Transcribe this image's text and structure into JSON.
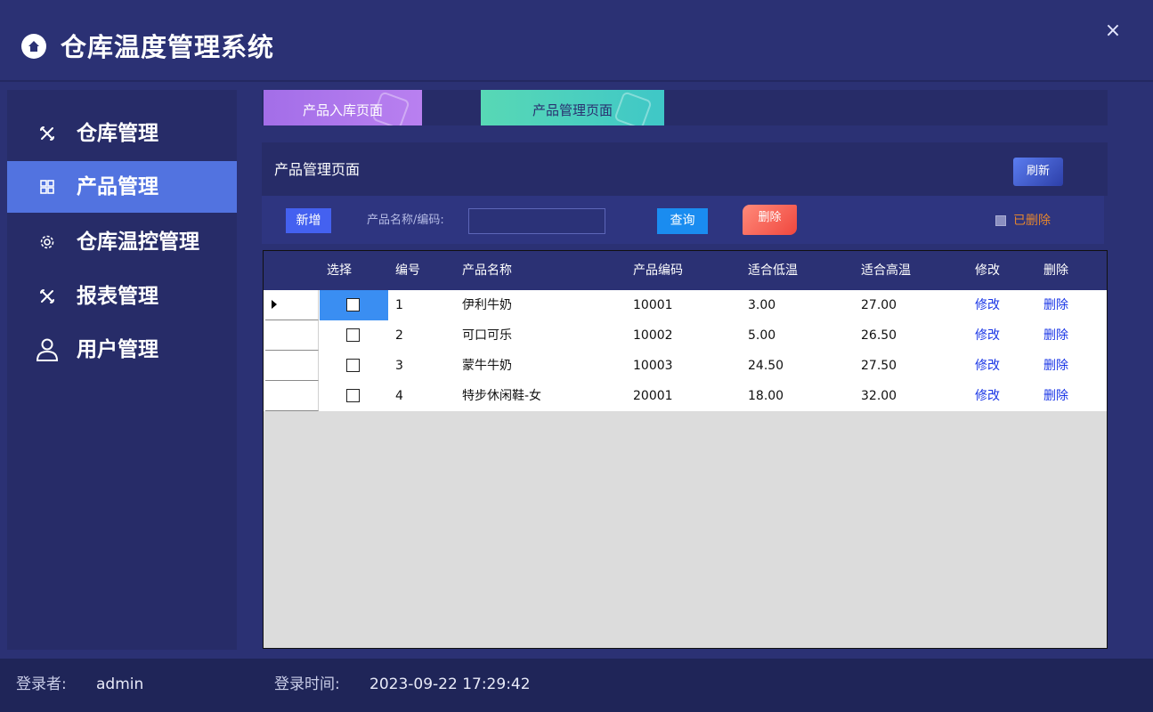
{
  "app": {
    "title": "仓库温度管理系统",
    "close_label": "×"
  },
  "sidebar": {
    "items": [
      {
        "label": "仓库管理",
        "icon": "tools-icon",
        "active": false
      },
      {
        "label": "产品管理",
        "icon": "grid-icon",
        "active": true
      },
      {
        "label": "仓库温控管理",
        "icon": "gear-icon",
        "active": false
      },
      {
        "label": "报表管理",
        "icon": "tools-icon",
        "active": false
      },
      {
        "label": "用户管理",
        "icon": "user-icon",
        "active": false
      }
    ]
  },
  "tabs": [
    {
      "label": "产品入库页面",
      "active": false
    },
    {
      "label": "产品管理页面",
      "active": true
    }
  ],
  "panel": {
    "title": "产品管理页面",
    "refresh_label": "刷新"
  },
  "toolbar": {
    "add_label": "新增",
    "search_label": "产品名称/编码:",
    "search_value": "",
    "query_label": "查询",
    "delete_label": "删除",
    "deleted_checkbox_label": "已删除"
  },
  "grid": {
    "columns": [
      "选择",
      "编号",
      "产品名称",
      "产品编码",
      "适合低温",
      "适合高温",
      "修改",
      "删除"
    ],
    "rows": [
      {
        "id": "1",
        "name": "伊利牛奶",
        "code": "10001",
        "low": "3.00",
        "high": "27.00",
        "edit": "修改",
        "delete": "删除"
      },
      {
        "id": "2",
        "name": "可口可乐",
        "code": "10002",
        "low": "5.00",
        "high": "26.50",
        "edit": "修改",
        "delete": "删除"
      },
      {
        "id": "3",
        "name": "蒙牛牛奶",
        "code": "10003",
        "low": "24.50",
        "high": "27.50",
        "edit": "修改",
        "delete": "删除"
      },
      {
        "id": "4",
        "name": "特步休闲鞋-女",
        "code": "20001",
        "low": "18.00",
        "high": "32.00",
        "edit": "修改",
        "delete": "删除"
      }
    ]
  },
  "footer": {
    "user_label": "登录者:",
    "user_value": "admin",
    "time_label": "登录时间:",
    "time_value": "2023-09-22 17:29:42"
  },
  "colors": {
    "background": "#2b3174",
    "sidebar_active": "#5273e0",
    "link": "#1a36e6",
    "deleted_label": "#e5862e"
  }
}
